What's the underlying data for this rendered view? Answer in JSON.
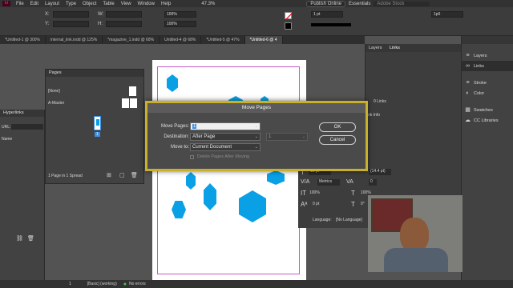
{
  "menubar": {
    "app_badge": "Id",
    "items": [
      "File",
      "Edit",
      "Layout",
      "Type",
      "Object",
      "Table",
      "View",
      "Window",
      "Help"
    ],
    "zoom": "47.3%",
    "publish": "Publish Online",
    "workspace": "Essentials",
    "search_placeholder": "Adobe Stock"
  },
  "controlbar": {
    "x_label": "X:",
    "y_label": "Y:",
    "w_label": "W:",
    "h_label": "H:",
    "stroke_weight": "1 pt",
    "percent_a": "100%",
    "percent_b": "100%",
    "gutter": "1p0"
  },
  "tabs": [
    "*Untitled-1 @ 300%",
    "internal_link.indd @ 125%",
    "*magazine_1.indd @ 68%",
    "Untitled-4 @ 68%",
    "*Untitled-5 @ 47%",
    "*Untitled-6 @ 4"
  ],
  "pages_panel": {
    "title": "Pages",
    "none_label": "[None]",
    "master_label": "A-Master",
    "page_number": "1",
    "footer": "1 Page in 1 Spread"
  },
  "hyperlinks_panel": {
    "title": "Hyperlinks",
    "url_label": "URL:",
    "name_col": "Name"
  },
  "layers_panel": {
    "tab_layers": "Layers",
    "tab_links": "Links",
    "links_count": "0 Links",
    "link_info": "nk Info"
  },
  "char_panel": {
    "size_value": "12 pt",
    "leading_value": "(14.4 pt)",
    "kerning_value": "Metrics",
    "tracking_value": "0",
    "scale_v": "100%",
    "scale_h": "100%",
    "baseline": "0 pt",
    "skew": "0°",
    "language_label": "Language:",
    "language_value": "[No Language]"
  },
  "right_dock": {
    "items": [
      {
        "icon": "layers-icon",
        "label": "Layers"
      },
      {
        "icon": "links-icon",
        "label": "Links"
      },
      {
        "icon": "stroke-icon",
        "label": "Stroke"
      },
      {
        "icon": "color-icon",
        "label": "Color"
      },
      {
        "icon": "swatches-icon",
        "label": "Swatches"
      },
      {
        "icon": "cc-libraries-icon",
        "label": "CC Libraries"
      }
    ]
  },
  "dialog": {
    "title": "Move Pages",
    "move_pages_label": "Move Pages:",
    "move_pages_value": "1",
    "destination_label": "Destination:",
    "destination_value": "After Page",
    "page_value": "1",
    "move_to_label": "Move to:",
    "move_to_value": "Current Document",
    "delete_label": "Delete Pages After Moving",
    "ok": "OK",
    "cancel": "Cancel"
  },
  "statusbar": {
    "page": "1",
    "style": "[Basic] (working)",
    "errors": "No errors"
  },
  "colors": {
    "hexagon": "#0aa0e6",
    "dialog_border": "#c9b02a",
    "app_badge": "#ff3366"
  }
}
